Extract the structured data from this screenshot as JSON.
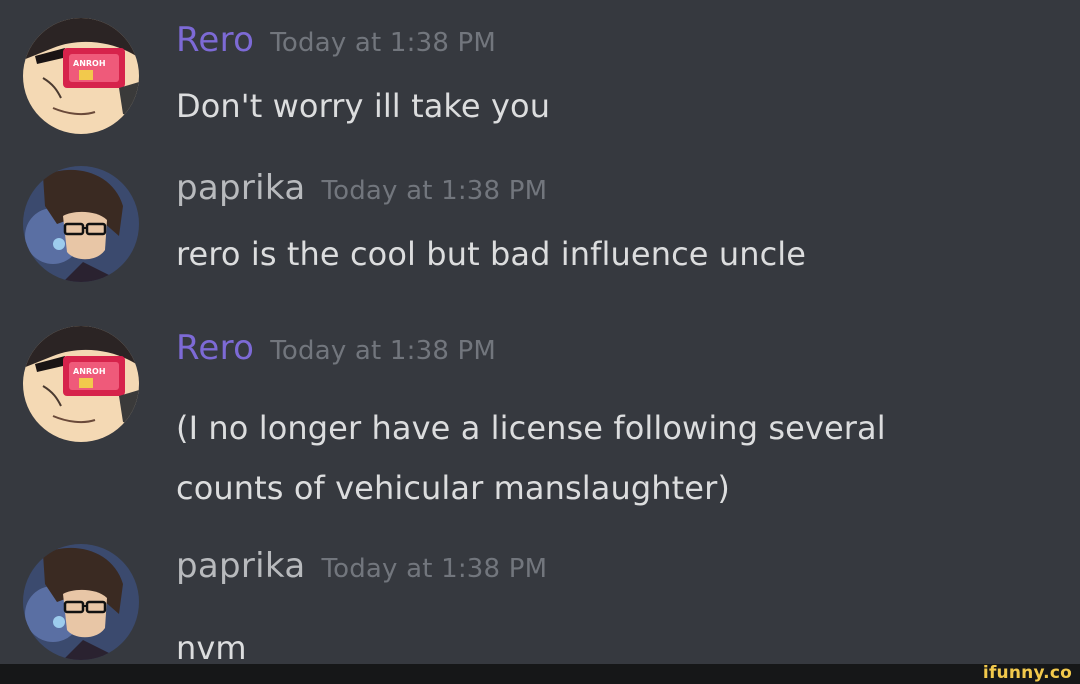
{
  "messages": [
    {
      "author": "Rero",
      "author_color": "#7d6ad6",
      "timestamp": "Today at 1:38 PM",
      "text": "Don't worry ill take you",
      "avatar": "rero-avatar"
    },
    {
      "author": "paprika",
      "author_color": "#b8babd",
      "timestamp": "Today at 1:38 PM",
      "text": "rero is the cool but bad influence uncle",
      "avatar": "paprika-avatar"
    },
    {
      "author": "Rero",
      "author_color": "#7d6ad6",
      "timestamp": "Today at 1:38 PM",
      "text": "(I no longer have a license following several counts of vehicular manslaughter)",
      "avatar": "rero-avatar"
    },
    {
      "author": "paprika",
      "author_color": "#b8babd",
      "timestamp": "Today at 1:38 PM",
      "text": "nvm",
      "avatar": "paprika-avatar"
    }
  ],
  "watermark": "ifunny.co",
  "colors": {
    "background": "#36393f",
    "message_text": "#dcddde",
    "timestamp": "#72767d",
    "footer": "#161718",
    "watermark": "#f2c94c"
  }
}
